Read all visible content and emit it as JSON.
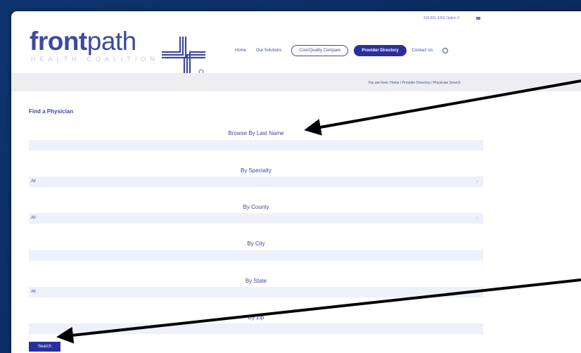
{
  "header": {
    "phone": "419.891.3266 Option 3",
    "logo_front": "front",
    "logo_path": "path",
    "logo_sub": "HEALTH COALITION"
  },
  "nav": {
    "home": "Home",
    "solutions": "Our Solutions",
    "cost": "Cost/Quality Compare",
    "provider": "Provider Directory",
    "contact": "Contact Us"
  },
  "breadcrumb": "You are here: Home / Provider Directory / Physician Search",
  "form": {
    "heading": "Find a Physician",
    "last_name": "Browse By Last Name",
    "specialty": "By Specialty",
    "specialty_value": "All",
    "county": "By County",
    "county_value": "All",
    "city": "By City",
    "state": "By State",
    "state_value": "All",
    "zip": "By Zip",
    "search_button": "Search"
  },
  "colors": {
    "brand": "#3d4a9e",
    "primary_button": "#2a2f9e",
    "frame": "#0b2a5c",
    "annotation_arrow": "#000000"
  }
}
